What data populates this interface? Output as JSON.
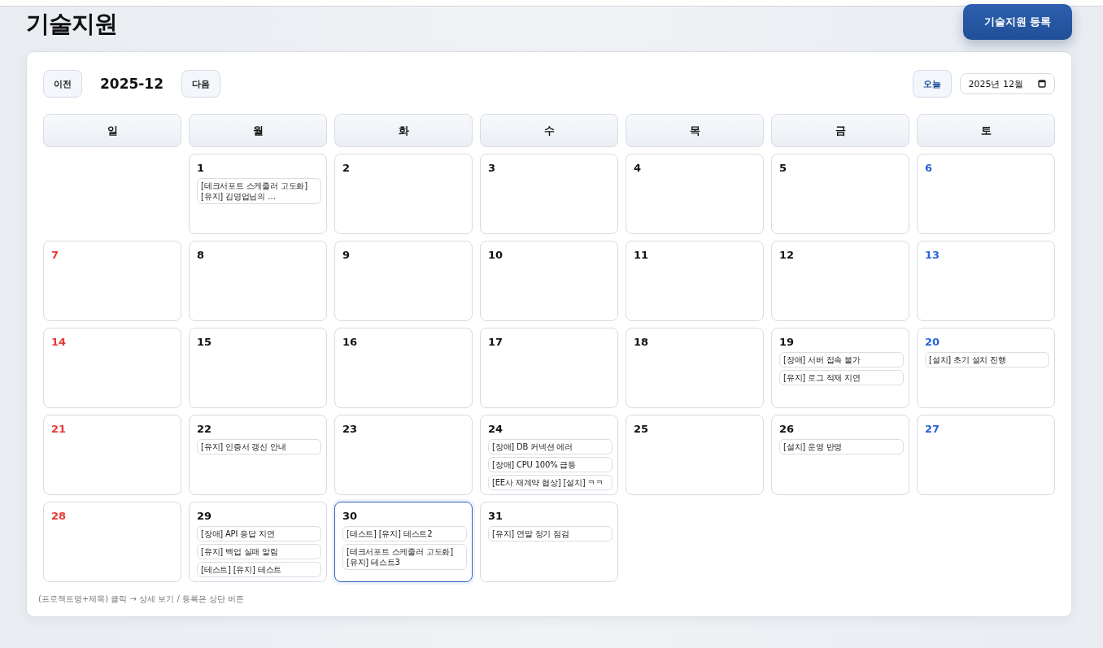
{
  "page_title": "기술지원",
  "register_button": "기술지원 등록",
  "toolbar": {
    "prev": "이전",
    "month": "2025-12",
    "next": "다음",
    "today": "오늘",
    "month_picker": "2025년 12월"
  },
  "weekdays": [
    {
      "label": "일"
    },
    {
      "label": "월"
    },
    {
      "label": "화"
    },
    {
      "label": "수"
    },
    {
      "label": "목"
    },
    {
      "label": "금"
    },
    {
      "label": "토"
    }
  ],
  "days": [
    {
      "kind": "blank"
    },
    {
      "kind": "day",
      "day": "1",
      "selected": false,
      "events": [
        "[테크서포트 스케줄러 고도화] [유지] 김영업님의 …"
      ]
    },
    {
      "kind": "day",
      "day": "2",
      "selected": false
    },
    {
      "kind": "day",
      "day": "3",
      "selected": false
    },
    {
      "kind": "day",
      "day": "4",
      "selected": false
    },
    {
      "kind": "day",
      "day": "5",
      "selected": false
    },
    {
      "kind": "day",
      "day": "6",
      "selected": false
    },
    {
      "kind": "day",
      "day": "7",
      "selected": false
    },
    {
      "kind": "day",
      "day": "8",
      "selected": false
    },
    {
      "kind": "day",
      "day": "9",
      "selected": false
    },
    {
      "kind": "day",
      "day": "10",
      "selected": false
    },
    {
      "kind": "day",
      "day": "11",
      "selected": false
    },
    {
      "kind": "day",
      "day": "12",
      "selected": false
    },
    {
      "kind": "day",
      "day": "13",
      "selected": false
    },
    {
      "kind": "day",
      "day": "14",
      "selected": false
    },
    {
      "kind": "day",
      "day": "15",
      "selected": false
    },
    {
      "kind": "day",
      "day": "16",
      "selected": false
    },
    {
      "kind": "day",
      "day": "17",
      "selected": false
    },
    {
      "kind": "day",
      "day": "18",
      "selected": false
    },
    {
      "kind": "day",
      "day": "19",
      "selected": false,
      "events": [
        "[장애] 서버 접속 불가",
        "[유지] 로그 적재 지연"
      ]
    },
    {
      "kind": "day",
      "day": "20",
      "selected": false,
      "events": [
        "[설치] 초기 설치 진행"
      ]
    },
    {
      "kind": "day",
      "day": "21",
      "selected": false
    },
    {
      "kind": "day",
      "day": "22",
      "selected": false,
      "events": [
        "[유지] 인증서 갱신 안내"
      ]
    },
    {
      "kind": "day",
      "day": "23",
      "selected": false
    },
    {
      "kind": "day",
      "day": "24",
      "selected": false,
      "events": [
        "[장애] DB 커넥션 에러",
        "[장애] CPU 100% 급등",
        "[EE사 재계약 협상] [설치] ㅋㅋ"
      ]
    },
    {
      "kind": "day",
      "day": "25",
      "selected": false
    },
    {
      "kind": "day",
      "day": "26",
      "selected": false,
      "events": [
        "[설치] 운영 반영"
      ]
    },
    {
      "kind": "day",
      "day": "27",
      "selected": false
    },
    {
      "kind": "day",
      "day": "28",
      "selected": false
    },
    {
      "kind": "day",
      "day": "29",
      "selected": false,
      "events": [
        "[장애] API 응답 지연",
        "[유지] 백업 실패 알림",
        "[테스트] [유지] 테스트"
      ]
    },
    {
      "kind": "day",
      "day": "30",
      "selected": true,
      "events": [
        "[테스트] [유지] 테스트2",
        "[테크서포트 스케줄러 고도화] [유지] 테스트3"
      ]
    },
    {
      "kind": "day",
      "day": "31",
      "selected": false,
      "events": [
        "[유지] 연말 정기 점검"
      ]
    }
  ],
  "hint": "(프로젝트명+제목) 클릭 → 상세 보기 / 등록은 상단 버튼"
}
